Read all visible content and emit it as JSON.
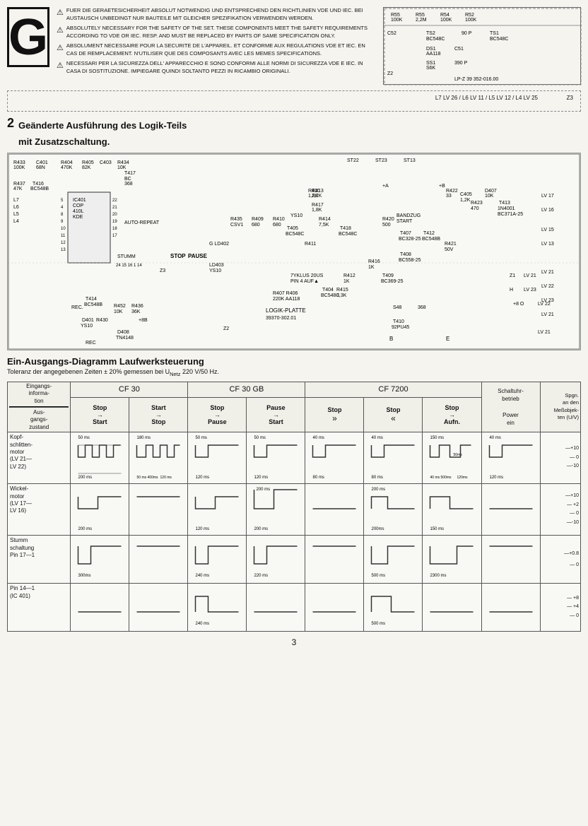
{
  "header": {
    "big_letter": "G",
    "warnings": [
      "FUER DIE GERAETESICHERHEIT ABSOLUT NOTWENDIG UND ENTSPRECHEND DEN RICHTLINIEN VDE UND IEC. BEI AUSTAUSCH UNBEDINGT NUR BAUTEILE MIT GLEICHER SPEZIFIKATION VERWENDEN WERDEN.",
      "ABSOLUTELY NECESSARY FOR THE SAFETY OF THE SET. THESE COMPONENTS MEET THE SAFETY REQUIREMENTS ACCORDING TO VDE OR IEC. RESP. AND MUST BE REPLACED BY PARTS OF SAME SPECIFICATION ONLY.",
      "ABSOLUMENT NECESSAIRE POUR LA SECURITE DE L'APPAREIL. ET CONFORME AUX REGULATIONS VDE ET IEC. EN CAS DE REMPLACEMENT. N'UTILISER QUE DES COMPOSANTS AVEC LES MEMES SPECIFICATIONS.",
      "NECESSARI PER LA SICUREZZA DELL' APPARECCHIO E SONO CONFORMI ALLE NORMI DI SICUREZZA VDE E IEC. IN CASA DI SOSTITUZIONE. IMPIEGARE QUINDI SOLTANTO PEZZI IN RICAMBIO ORIGINALI."
    ]
  },
  "section1": {
    "title1": "Geänderte Ausführung des Logik-Teils",
    "title2": "mit Zusatzschaltung."
  },
  "diagram": {
    "title": "Ein-Ausgangs-Diagramm Laufwerksteuerung",
    "subtitle": "Toleranz der angegebenen Zeiten ± 20% gemessen bei U",
    "subtitle_sub": "Netz",
    "subtitle_end": " 220 V/50 Hz.",
    "cf_sections": [
      "CF 30",
      "CF 30 GB",
      "CF 7200"
    ],
    "columns": {
      "cf30": [
        {
          "input": "Stop",
          "output": "Start",
          "arrow": "→"
        },
        {
          "input": "Start",
          "output": "Stop",
          "arrow": "→"
        },
        {
          "input": "Stop",
          "output": "Pause",
          "arrow": "→"
        },
        {
          "input": "Pause",
          "output": "Start",
          "arrow": "→"
        }
      ],
      "cf30gb": [
        {
          "input": "Stop",
          "output": "»",
          "arrow": "→"
        },
        {
          "input": "Stop",
          "output": "«",
          "arrow": "→"
        },
        {
          "input": "Stop",
          "output": "Aufn.",
          "arrow": "→"
        }
      ]
    },
    "right_headers": {
      "schaltuhr": "Schaltuhr- betrieb Power ein",
      "spgn": "Spgn. an den Meßobjek- ten (U/V)"
    },
    "rows": [
      {
        "label": "Kopf-\nschlitten-\nmotor\n(LV 21—\nLV 22)",
        "timing_data": [
          {
            "ms_top": "50 ms",
            "ms_bot": "200 ms",
            "pulse_count": 4
          },
          {
            "ms_top": "180 ms",
            "ms_bot": "50 ms 400ms 120 ms",
            "pulse_count": 4
          },
          {
            "ms_top": "50 ms",
            "ms_bot": "120 ms"
          },
          {
            "ms_top": "50 ms",
            "ms_bot": "120 ms"
          },
          {
            "ms_top": "40 ms",
            "ms_bot": "80 ms"
          },
          {
            "ms_top": "40 ms",
            "ms_bot": "80 ms"
          },
          {
            "ms_top": "150 ms",
            "ms_bot": "40 ms 500ms 120 ms",
            "pulse_count": 3
          },
          {
            "ms_top": "40 ms",
            "ms_bot": "120 ms"
          }
        ],
        "spgn_values": [
          "+10",
          "0",
          "-10"
        ]
      },
      {
        "label": "Wickel-\nmotor\n(LV 17—\nLV 16)",
        "timing_data": [
          {
            "ms_top": "",
            "ms_bot": "200 ms"
          },
          {
            "ms_top": "",
            "ms_bot": ""
          },
          {
            "ms_top": "",
            "ms_bot": "120 ms"
          },
          {
            "ms_top": "200 ms",
            "ms_bot": "200 ms"
          },
          {
            "ms_top": "",
            "ms_bot": ""
          },
          {
            "ms_top": "",
            "ms_bot": "200 ms"
          },
          {
            "ms_top": "",
            "ms_bot": "150 ms"
          },
          {
            "ms_top": "",
            "ms_bot": ""
          }
        ],
        "spgn_values": [
          "+10",
          "+2",
          "0",
          "-10"
        ]
      },
      {
        "label": "Stumm\nschaltung\nPin 17—1",
        "timing_data": [
          {
            "ms_top": "300ms",
            "ms_bot": ""
          },
          {
            "ms_top": "",
            "ms_bot": ""
          },
          {
            "ms_top": "240 ms",
            "ms_bot": ""
          },
          {
            "ms_top": "220 ms",
            "ms_bot": ""
          },
          {
            "ms_top": "",
            "ms_bot": ""
          },
          {
            "ms_top": "",
            "ms_bot": "500 ms"
          },
          {
            "ms_top": "",
            "ms_bot": "2300 ms"
          },
          {
            "ms_top": "",
            "ms_bot": ""
          }
        ],
        "spgn_values": [
          "+0.8",
          "0"
        ]
      },
      {
        "label": "Pin 14—1\n(IC 401)",
        "timing_data": [
          {
            "ms_top": "",
            "ms_bot": ""
          },
          {
            "ms_top": "",
            "ms_bot": ""
          },
          {
            "ms_top": "240 ms",
            "ms_bot": ""
          },
          {
            "ms_top": "",
            "ms_bot": ""
          },
          {
            "ms_top": "",
            "ms_bot": ""
          },
          {
            "ms_top": "500 ms",
            "ms_bot": ""
          },
          {
            "ms_top": "",
            "ms_bot": ""
          },
          {
            "ms_top": "",
            "ms_bot": ""
          }
        ],
        "spgn_values": [
          "+8",
          "+4",
          "0"
        ]
      }
    ]
  },
  "page_number": "3"
}
